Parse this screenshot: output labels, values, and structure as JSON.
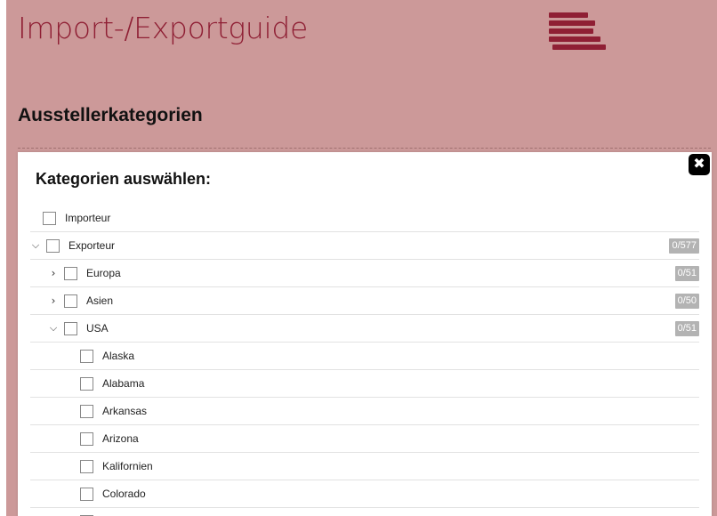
{
  "header": {
    "app_title": "Import-/Exportguide",
    "menu_icon": "hamburger-menu-icon"
  },
  "section": {
    "title": "Ausstellerkategorien"
  },
  "modal": {
    "title": "Kategorien auswählen:",
    "close_icon": "close-icon",
    "close_glyph": "✖"
  },
  "tree": {
    "importeur": {
      "label": "Importeur",
      "checked": false
    },
    "exporteur": {
      "label": "Exporteur",
      "checked": false,
      "expanded": true,
      "count": "0/577"
    },
    "europa": {
      "label": "Europa",
      "checked": false,
      "expanded": false,
      "count": "0/51"
    },
    "asien": {
      "label": "Asien",
      "checked": false,
      "expanded": false,
      "count": "0/50"
    },
    "usa": {
      "label": "USA",
      "checked": false,
      "expanded": true,
      "count": "0/51"
    },
    "states": [
      {
        "label": "Alaska",
        "checked": false
      },
      {
        "label": "Alabama",
        "checked": false
      },
      {
        "label": "Arkansas",
        "checked": false
      },
      {
        "label": "Arizona",
        "checked": false
      },
      {
        "label": "Kalifornien",
        "checked": false
      },
      {
        "label": "Colorado",
        "checked": false
      }
    ]
  },
  "colors": {
    "page_background": "#cc9999",
    "brand": "#8f1f34",
    "badge": "#b3b3b3"
  }
}
